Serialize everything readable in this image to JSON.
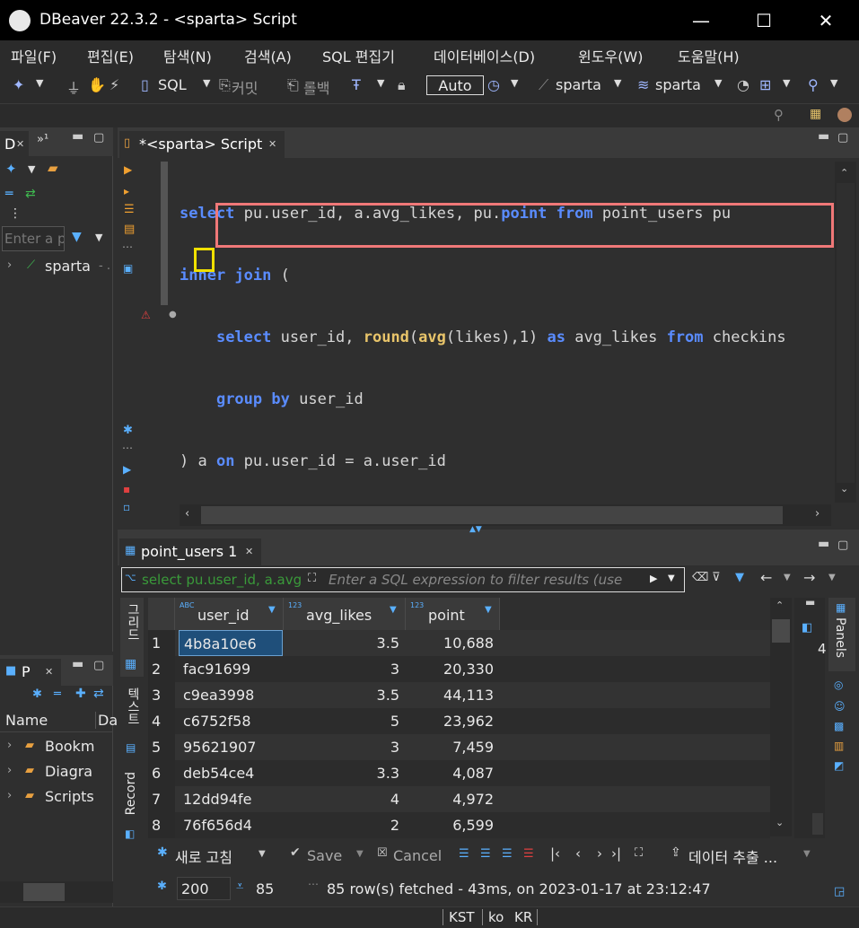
{
  "window": {
    "title": "DBeaver 22.3.2 - <sparta> Script"
  },
  "menu": [
    "파일(F)",
    "편집(E)",
    "탐색(N)",
    "검색(A)",
    "SQL 편집기",
    "데이터베이스(D)",
    "윈도우(W)",
    "도움말(H)"
  ],
  "toolbar": {
    "sql_label": "SQL",
    "commit_label": "커밋",
    "rollback_label": "롤백",
    "auto_label": "Auto",
    "datasource": "sparta",
    "schema": "sparta"
  },
  "left_panel": {
    "tab_label": "D",
    "filter_placeholder": "Enter a p",
    "tree_item": "sparta",
    "tree_item_suffix": "- ."
  },
  "projects_panel": {
    "tab_label": "P",
    "column_name": "Name",
    "column_da": "Da",
    "items": [
      "Bookm",
      "Diagra",
      "Scripts"
    ]
  },
  "editor": {
    "tab_label": "*<sparta> Script",
    "lines": [
      [
        [
          "kw",
          "select"
        ],
        [
          "plain",
          " pu.user_id, a.avg_likes, pu."
        ],
        [
          "kw",
          "point"
        ],
        [
          "plain",
          " "
        ],
        [
          "kw",
          "from"
        ],
        [
          "plain",
          " point_users pu"
        ]
      ],
      [
        [
          "kw",
          "inner"
        ],
        [
          "plain",
          " "
        ],
        [
          "kw",
          "join"
        ],
        [
          "plain",
          " ("
        ]
      ],
      [
        [
          "plain",
          "    "
        ],
        [
          "kw",
          "select"
        ],
        [
          "plain",
          " user_id, "
        ],
        [
          "fn",
          "round"
        ],
        [
          "plain",
          "("
        ],
        [
          "fn",
          "avg"
        ],
        [
          "plain",
          "(likes),1) "
        ],
        [
          "kw",
          "as"
        ],
        [
          "plain",
          " avg_likes "
        ],
        [
          "kw",
          "from"
        ],
        [
          "plain",
          " checkins"
        ]
      ],
      [
        [
          "plain",
          "    "
        ],
        [
          "kw",
          "group"
        ],
        [
          "plain",
          " "
        ],
        [
          "kw",
          "by"
        ],
        [
          "plain",
          " user_id"
        ]
      ],
      [
        [
          "plain",
          ") a "
        ],
        [
          "kw",
          "on"
        ],
        [
          "plain",
          " pu.user_id = a.user_id"
        ]
      ]
    ]
  },
  "results": {
    "tab_label": "point_users 1",
    "filter_query": "select pu.user_id, a.avg",
    "filter_placeholder": "Enter a SQL expression to filter results (use",
    "columns": [
      "user_id",
      "avg_likes",
      "point"
    ],
    "rows": [
      [
        "1",
        "4b8a10e6",
        "3.5",
        "10,688"
      ],
      [
        "2",
        "fac91699",
        "3",
        "20,330"
      ],
      [
        "3",
        "c9ea3998",
        "3.5",
        "44,113"
      ],
      [
        "4",
        "c6752f58",
        "5",
        "23,962"
      ],
      [
        "5",
        "95621907",
        "3",
        "7,459"
      ],
      [
        "6",
        "deb54ce4",
        "3.3",
        "4,087"
      ],
      [
        "7",
        "12dd94fe",
        "4",
        "4,972"
      ],
      [
        "8",
        "76f656d4",
        "2",
        "6,599"
      ]
    ],
    "side_tabs": [
      "그리드",
      "텍스트",
      "Record"
    ],
    "panels_label": "Panels",
    "panels_value": "4",
    "refresh_label": "새로 고침",
    "save_label": "Save",
    "cancel_label": "Cancel",
    "export_label": "데이터 추출 ...",
    "fetch_size": "200",
    "row_count": "85",
    "status": "85 row(s) fetched - 43ms, on 2023-01-17 at 23:12:47"
  },
  "statusbar": {
    "timezone": "KST",
    "locale_lang": "ko",
    "locale_country": "KR"
  }
}
